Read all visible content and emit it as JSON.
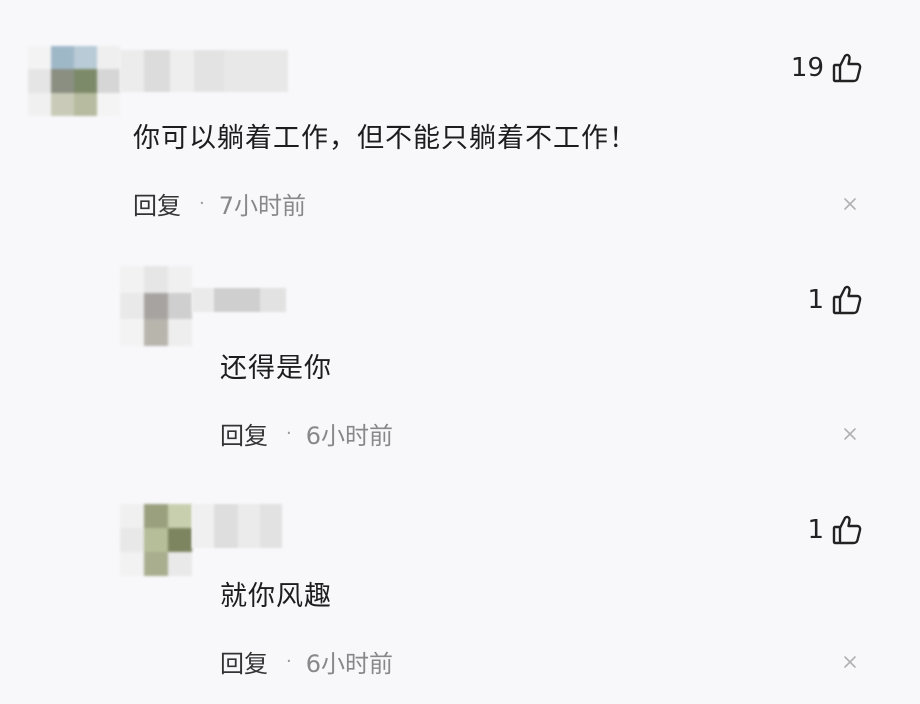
{
  "comments": [
    {
      "text": "你可以躺着工作，但不能只躺着不工作！",
      "likes": "19",
      "reply_label": "回复",
      "separator": "·",
      "time": "7小时前"
    },
    {
      "text": "还得是你",
      "likes": "1",
      "reply_label": "回复",
      "separator": "·",
      "time": "6小时前"
    },
    {
      "text": "就你风趣",
      "likes": "1",
      "reply_label": "回复",
      "separator": "·",
      "time": "6小时前"
    }
  ],
  "icons": {
    "like": "thumbs-up-icon",
    "close": "close-icon"
  },
  "colors": {
    "background": "#f8f8fb",
    "text": "#1d1d1f",
    "muted": "#888888"
  }
}
